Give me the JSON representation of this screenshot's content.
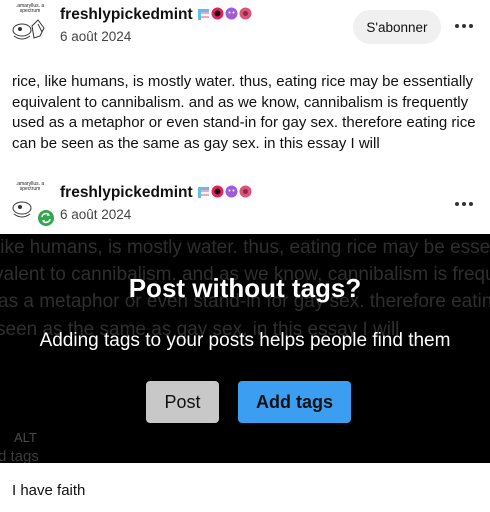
{
  "post1": {
    "username": "freshlypickedmint",
    "date": "6 août 2024",
    "avatar_text": ".amaryllus. a spectrum",
    "subscribe_label": "S'abonner",
    "more_icon": "more-horizontal-icon",
    "body": "rice, like humans, is mostly water. thus, eating rice may be essentially equivalent to cannibalism. and as we know, cannibalism is frequently used as a metaphor or even stand-in for gay sex. therefore eating rice can be seen as the same as gay sex. in this essay I will"
  },
  "post2": {
    "username": "freshlypickedmint",
    "date": "6 août 2024",
    "avatar_text": ".amaryllus. a spectrum",
    "reblog_icon": "reblog-icon",
    "more_icon": "more-horizontal-icon"
  },
  "modal": {
    "title": "Post without tags?",
    "subtitle": "Adding tags to your posts helps people find them",
    "post_label": "Post",
    "add_tags_label": "Add tags",
    "background_lines": [
      "like humans, is mostly water. thus, eating rice may be essen",
      "valent to cannibalism. and as we know, cannibalism is frequ",
      "as a metaphor or even stand-in for gay sex. therefore eatin",
      "seen as the same as gay sex. in this essay I will"
    ],
    "background_alt": "ALT",
    "background_tags": "d tags"
  },
  "reply": {
    "text": "I have faith"
  },
  "colors": {
    "accent_blue": "#3b9ef0",
    "reblog_green": "#2ea84a",
    "overlay": "#000000"
  }
}
